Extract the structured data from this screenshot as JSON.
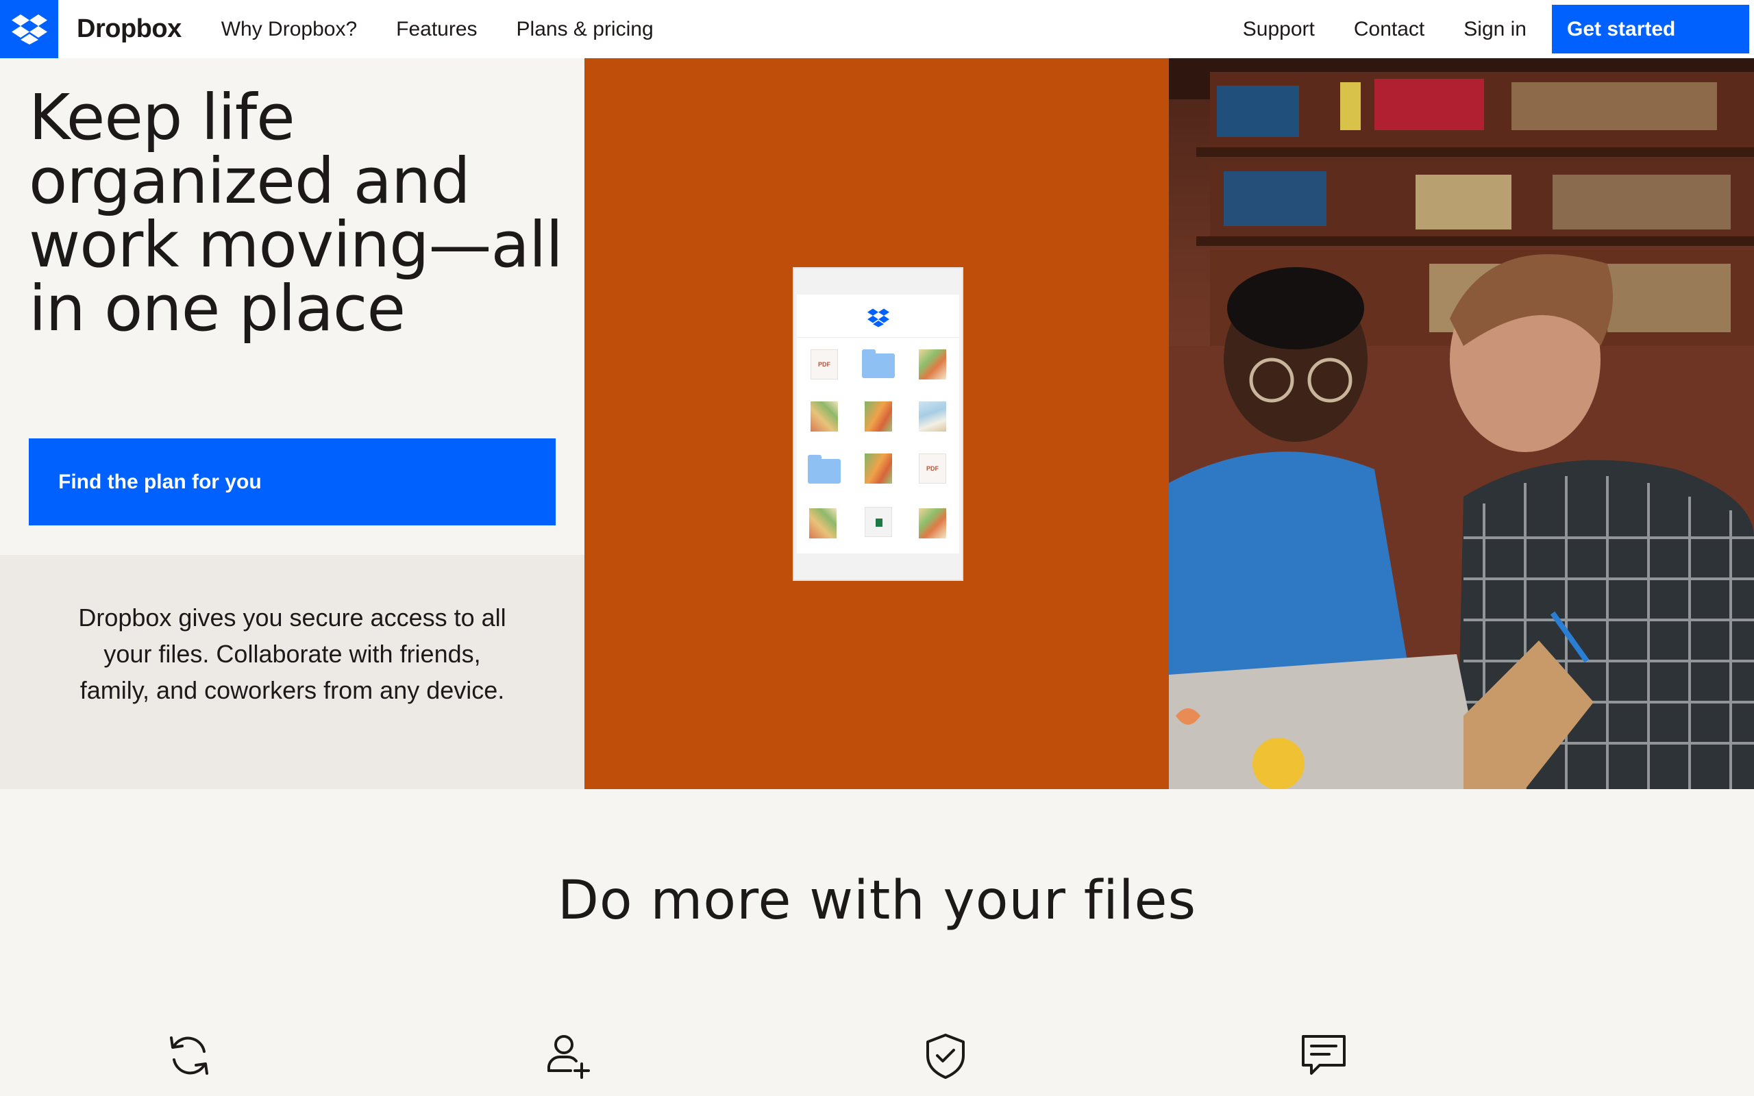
{
  "nav": {
    "brand": "Dropbox",
    "links": [
      "Why Dropbox?",
      "Features",
      "Plans & pricing"
    ],
    "right_links": [
      "Support",
      "Contact",
      "Sign in"
    ],
    "cta_label": "Get started"
  },
  "hero": {
    "title": "Keep life organized and work moving—all in one place",
    "button_label": "Find the plan for you",
    "description": "Dropbox gives you secure access to all your files. Collaborate with friends, family, and coworkers from any device.",
    "phone_files": [
      {
        "type": "pdf",
        "label": "PDF"
      },
      {
        "type": "folder"
      },
      {
        "type": "image"
      },
      {
        "type": "image"
      },
      {
        "type": "image"
      },
      {
        "type": "image"
      },
      {
        "type": "folder"
      },
      {
        "type": "image"
      },
      {
        "type": "pdf",
        "label": "PDF"
      },
      {
        "type": "image"
      },
      {
        "type": "spreadsheet"
      },
      {
        "type": "image"
      }
    ]
  },
  "section": {
    "title": "Do more with your files",
    "feature_icons": [
      "sync-icon",
      "add-user-icon",
      "shield-check-icon",
      "chat-icon"
    ]
  },
  "colors": {
    "brand_blue": "#0061fe",
    "hero_orange": "#c04e0b",
    "background": "#f7f5f2",
    "desc_background": "#edeae6",
    "text": "#1e1919"
  }
}
